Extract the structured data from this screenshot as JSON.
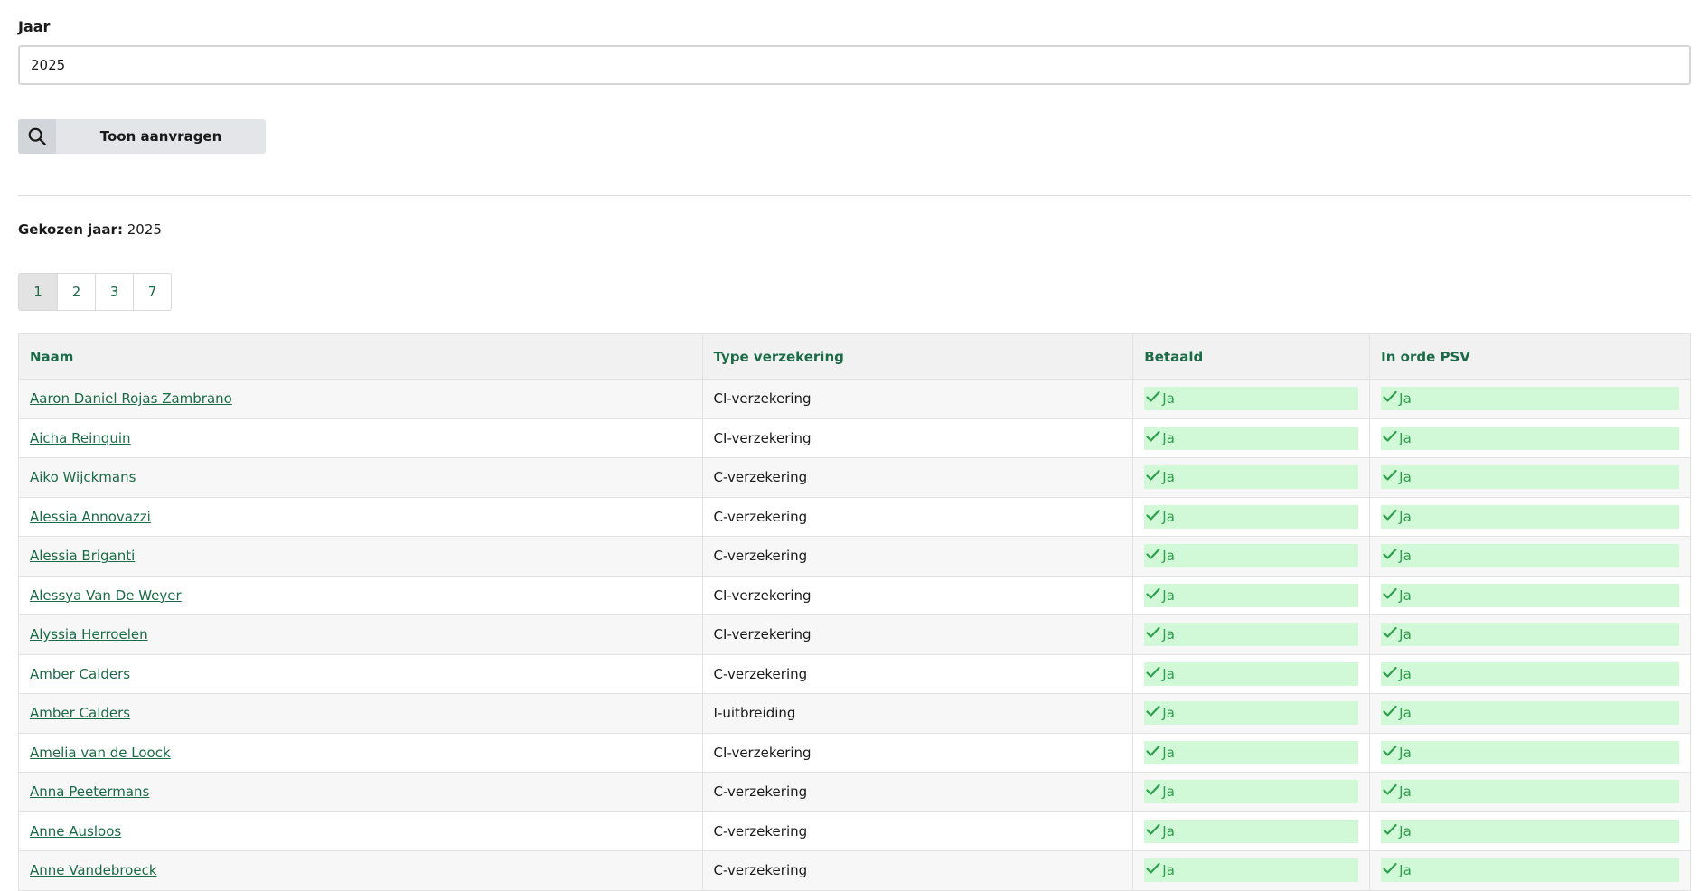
{
  "filter": {
    "year_label": "Jaar",
    "year_value": "2025",
    "search_button_label": "Toon aanvragen",
    "search_icon": "search-icon"
  },
  "result": {
    "chosen_year_label": "Gekozen jaar:",
    "chosen_year_value": "2025"
  },
  "pagination": {
    "pages": [
      "1",
      "2",
      "3",
      "7"
    ],
    "active": "1"
  },
  "table": {
    "headers": {
      "name": "Naam",
      "type": "Type verzekering",
      "paid": "Betaald",
      "psv": "In orde PSV"
    },
    "status_icon": "check-icon",
    "colors": {
      "link": "#1a6b46",
      "status_bg": "#d1f9d8",
      "status_text": "#2f9e4d"
    },
    "rows": [
      {
        "name": "Aaron Daniel Rojas Zambrano",
        "type": "CI-verzekering",
        "paid": "Ja",
        "psv": "Ja"
      },
      {
        "name": "Aicha Reinquin",
        "type": "CI-verzekering",
        "paid": "Ja",
        "psv": "Ja"
      },
      {
        "name": "Aiko Wijckmans",
        "type": "C-verzekering",
        "paid": "Ja",
        "psv": "Ja"
      },
      {
        "name": "Alessia Annovazzi",
        "type": "C-verzekering",
        "paid": "Ja",
        "psv": "Ja"
      },
      {
        "name": "Alessia Briganti",
        "type": "C-verzekering",
        "paid": "Ja",
        "psv": "Ja"
      },
      {
        "name": "Alessya Van De Weyer",
        "type": "CI-verzekering",
        "paid": "Ja",
        "psv": "Ja"
      },
      {
        "name": "Alyssia Herroelen",
        "type": "CI-verzekering",
        "paid": "Ja",
        "psv": "Ja"
      },
      {
        "name": "Amber Calders",
        "type": "C-verzekering",
        "paid": "Ja",
        "psv": "Ja"
      },
      {
        "name": "Amber Calders",
        "type": "I-uitbreiding",
        "paid": "Ja",
        "psv": "Ja"
      },
      {
        "name": "Amelia van de Loock",
        "type": "CI-verzekering",
        "paid": "Ja",
        "psv": "Ja"
      },
      {
        "name": "Anna Peetermans",
        "type": "C-verzekering",
        "paid": "Ja",
        "psv": "Ja"
      },
      {
        "name": "Anne Ausloos",
        "type": "C-verzekering",
        "paid": "Ja",
        "psv": "Ja"
      },
      {
        "name": "Anne Vandebroeck",
        "type": "C-verzekering",
        "paid": "Ja",
        "psv": "Ja"
      }
    ]
  }
}
